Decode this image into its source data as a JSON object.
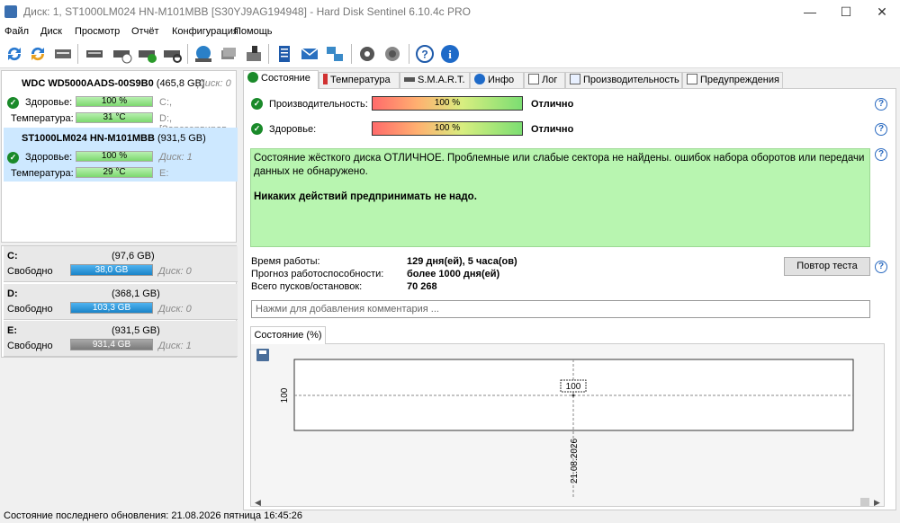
{
  "window": {
    "title": "Диск: 1, ST1000LM024 HN-M101MBB [S30YJ9AG194948]  -  Hard Disk Sentinel 6.10.4c PRO",
    "minimize": "—",
    "maximize": "☐",
    "close": "✕"
  },
  "menu": [
    "Файл",
    "Диск",
    "Просмотр",
    "Отчёт",
    "Конфигурация",
    "Помощь"
  ],
  "disks": [
    {
      "name": "WDC WD5000AADS-00S9B0",
      "size": "(465,8 GB)",
      "tag": "Диск: 0",
      "health_label": "Здоровье:",
      "health": "100 %",
      "health_extra": "C:,",
      "temp_label": "Температура:",
      "temp": "31 °C",
      "temp_extra": "D:, [Зарезервиров",
      "selected": false
    },
    {
      "name": "ST1000LM024 HN-M101MBB",
      "size": "(931,5 GB)",
      "tag": "",
      "health_label": "Здоровье:",
      "health": "100 %",
      "health_extra": "Диск: 1",
      "temp_label": "Температура:",
      "temp": "29 °C",
      "temp_extra": "E:",
      "selected": true
    }
  ],
  "volumes": [
    {
      "letter": "C:",
      "size": "(97,6 GB)",
      "free_label": "Свободно",
      "free": "38,0 GB",
      "bar_color": "blue",
      "tag": "Диск: 0"
    },
    {
      "letter": "D:",
      "size": "(368,1 GB)",
      "free_label": "Свободно",
      "free": "103,3 GB",
      "bar_color": "blue",
      "tag": "Диск: 0"
    },
    {
      "letter": "E:",
      "size": "(931,5 GB)",
      "free_label": "Свободно",
      "free": "931,4 GB",
      "bar_color": "gray",
      "tag": "Диск: 1"
    }
  ],
  "tabs": [
    "Состояние",
    "Температура",
    "S.M.A.R.T.",
    "Инфо",
    "Лог",
    "Производительность",
    "Предупреждения"
  ],
  "status": {
    "performance_label": "Производительность:",
    "performance_value": "100 %",
    "performance_status": "Отлично",
    "health_label": "Здоровье:",
    "health_value": "100 %",
    "health_status": "Отлично",
    "description": "Состояние жёсткого диска ОТЛИЧНОЕ. Проблемные или слабые сектора не найдены. ошибок набора оборотов или передачи данных не обнаружено.",
    "advice": "Никаких действий предпринимать не надо.",
    "uptime_label": "Время работы:",
    "uptime": "129 дня(ей), 5 часа(ов)",
    "forecast_label": "Прогноз работоспособности:",
    "forecast": "более 1000 дня(ей)",
    "starts_label": "Всего пусков/остановок:",
    "starts": "70 268",
    "retest_button": "Повтор теста",
    "comment_placeholder": "Нажми для добавления комментария ..."
  },
  "chart_tab": "Состояние (%)",
  "chart_data": {
    "type": "line",
    "x": [
      "21.08.2026"
    ],
    "y": [
      100
    ],
    "ylabel": "100",
    "point_label": "100",
    "xtick": "21.08.2026"
  },
  "statusbar": "Состояние последнего обновления: 21.08.2026 пятница 16:45:26"
}
